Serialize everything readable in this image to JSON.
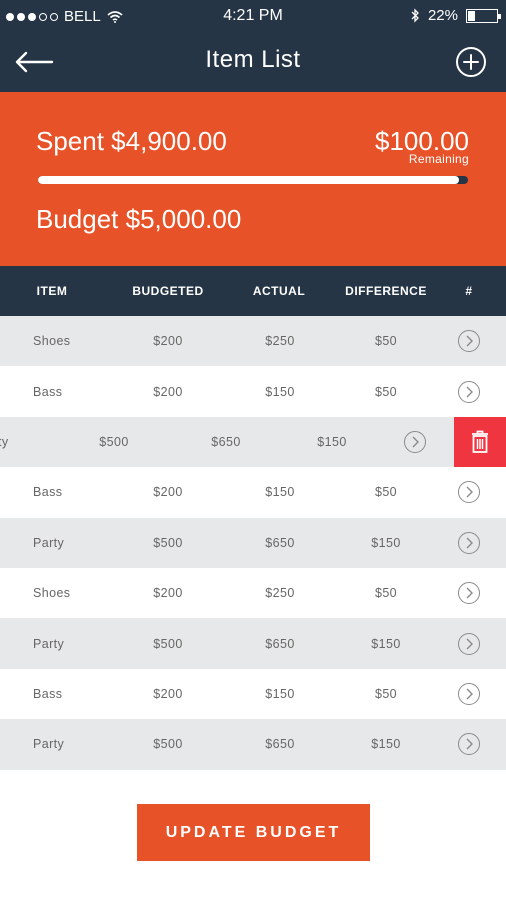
{
  "status_bar": {
    "carrier": "BELL",
    "time": "4:21 PM",
    "battery": "22%",
    "battery_level": 0.22
  },
  "nav": {
    "title": "Item List",
    "back_icon": "arrow-left-icon",
    "add_icon": "plus-circle-icon"
  },
  "summary": {
    "spent": "Spent $4,900.00",
    "remaining_amount": "$100.00",
    "remaining_label": "Remaining",
    "budget": "Budget $5,000.00",
    "progress": 0.98
  },
  "table": {
    "headers": [
      "ITEM",
      "BUDGETED",
      "ACTUAL",
      "DIFFERENCE",
      "#"
    ],
    "rows": [
      {
        "item": "Shoes",
        "budgeted": "$200",
        "actual": "$250",
        "difference": "$50"
      },
      {
        "item": "Bass",
        "budgeted": "$200",
        "actual": "$150",
        "difference": "$50"
      },
      {
        "item": "ty",
        "budgeted": "$500",
        "actual": "$650",
        "difference": "$150",
        "swiped": true
      },
      {
        "item": "Bass",
        "budgeted": "$200",
        "actual": "$150",
        "difference": "$50"
      },
      {
        "item": "Party",
        "budgeted": "$500",
        "actual": "$650",
        "difference": "$150"
      },
      {
        "item": "Shoes",
        "budgeted": "$200",
        "actual": "$250",
        "difference": "$50"
      },
      {
        "item": "Party",
        "budgeted": "$500",
        "actual": "$650",
        "difference": "$150"
      },
      {
        "item": "Bass",
        "budgeted": "$200",
        "actual": "$150",
        "difference": "$50"
      },
      {
        "item": "Party",
        "budgeted": "$500",
        "actual": "$650",
        "difference": "$150"
      }
    ]
  },
  "button": {
    "label": "UPDATE BUDGET"
  },
  "colors": {
    "navy": "#253545",
    "accent": "#e75228",
    "delete": "#ef3540",
    "row_gray": "#e7e8e9"
  }
}
